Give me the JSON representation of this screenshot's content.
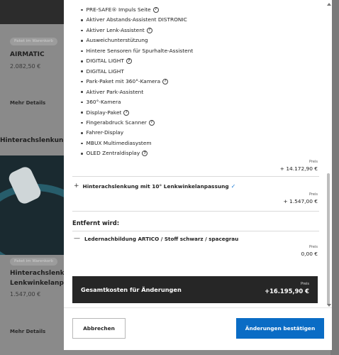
{
  "background": {
    "cards": [
      {
        "badge": "Paket im Warenkorb",
        "title": "AIRMATIC",
        "price": "2.082,50 €",
        "link": "Mehr Details"
      },
      {
        "badge": "Paket im Warenkorb",
        "title_line1": "Hinterachslenkung",
        "title_line2": "Lenkwinkelanpassung",
        "price": "1.547,00 €",
        "link": "Mehr Details"
      }
    ],
    "section_heading": "Hinterachslenkung"
  },
  "modal": {
    "features": [
      {
        "label": "PRE-SAFE® Impuls Seite",
        "info": true
      },
      {
        "label": "Aktiver Abstands-Assistent DISTRONIC",
        "info": false
      },
      {
        "label": "Aktiver Lenk-Assistent",
        "info": true
      },
      {
        "label": "Ausweichunterstützung",
        "info": false
      },
      {
        "label": "Hintere Sensoren für Spurhalte-Assistent",
        "info": false
      },
      {
        "label": "DIGITAL LIGHT",
        "info": true
      },
      {
        "label": "DIGITAL LIGHT",
        "info": false
      },
      {
        "label": "Park-Paket mit 360°-Kamera",
        "info": true
      },
      {
        "label": "Aktiver Park-Assistent",
        "info": false
      },
      {
        "label": "360°-Kamera",
        "info": false
      },
      {
        "label": "Display-Paket",
        "info": true
      },
      {
        "label": "Fingerabdruck Scanner",
        "info": true
      },
      {
        "label": "Fahrer-Display",
        "info": false
      },
      {
        "label": "MBUX Multimediasystem",
        "info": false
      },
      {
        "label": "OLED Zentraldisplay",
        "info": true
      }
    ],
    "info_symbol": "?",
    "package1_price_label": "Preis",
    "package1_price": "+ 14.172,90 €",
    "added_item": {
      "plus": "+",
      "label": "Hinterachslenkung mit 10° Lenkwinkelanpassung",
      "check": "✓",
      "price_label": "Preis",
      "price": "+ 1.547,00 €"
    },
    "removed_title": "Entfernt wird:",
    "removed_item": {
      "minus": "—",
      "label": "Ledernachbildung ARTICO / Stoff schwarz / spacegrau",
      "price_label": "Preis",
      "price": "0,00 €"
    },
    "total": {
      "label": "Gesamtkosten für Änderungen",
      "price_label": "Preis",
      "price": "+16.195,90 €"
    },
    "buttons": {
      "cancel": "Abbrechen",
      "confirm": "Änderungen bestätigen"
    },
    "colors": {
      "accent": "#0a6cc5",
      "total_bg": "#262626"
    }
  }
}
